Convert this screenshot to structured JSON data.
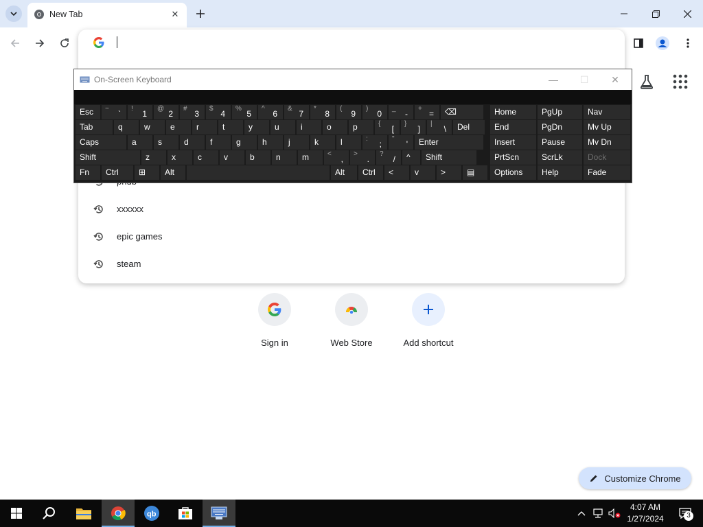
{
  "browser": {
    "tab_title": "New Tab",
    "omnibox_value": "",
    "suggestions": [
      "phub",
      "xxxxxx",
      "epic games",
      "steam"
    ]
  },
  "ntp": {
    "shortcuts": [
      {
        "name": "Sign in",
        "icon": "google-g-icon"
      },
      {
        "name": "Web Store",
        "icon": "chrome-web-store-icon"
      },
      {
        "name": "Add shortcut",
        "icon": "plus-icon"
      }
    ],
    "customize_label": "Customize Chrome"
  },
  "osk": {
    "title": "On-Screen Keyboard",
    "row1": [
      {
        "main": "Esc"
      },
      {
        "sym": "~",
        "num": "`"
      },
      {
        "sym": "!",
        "num": "1"
      },
      {
        "sym": "@",
        "num": "2"
      },
      {
        "sym": "#",
        "num": "3"
      },
      {
        "sym": "$",
        "num": "4"
      },
      {
        "sym": "%",
        "num": "5"
      },
      {
        "sym": "^",
        "num": "6"
      },
      {
        "sym": "&",
        "num": "7"
      },
      {
        "sym": "*",
        "num": "8"
      },
      {
        "sym": "(",
        "num": "9"
      },
      {
        "sym": ")",
        "num": "0"
      },
      {
        "sym": "_",
        "num": "-"
      },
      {
        "sym": "+",
        "num": "="
      },
      {
        "main": "⌫"
      }
    ],
    "row2": [
      "Tab",
      "q",
      "w",
      "e",
      "r",
      "t",
      "y",
      "u",
      "i",
      "o",
      "p",
      "[",
      "]",
      "\\",
      "Del"
    ],
    "row2_syms": {
      "[": "{",
      "]": "}",
      "\\": "|"
    },
    "row3": [
      "Caps",
      "a",
      "s",
      "d",
      "f",
      "g",
      "h",
      "j",
      "k",
      "l",
      ";",
      "'",
      "Enter"
    ],
    "row3_syms": {
      ";": ":",
      "'": "\""
    },
    "row4": [
      "Shift",
      "z",
      "x",
      "c",
      "v",
      "b",
      "n",
      "m",
      ",",
      ".",
      "/",
      "^",
      "Shift"
    ],
    "row4_syms": {
      ",": "<",
      ".": ">",
      "/": "?"
    },
    "row5": [
      "Fn",
      "Ctrl",
      "⊞",
      "Alt",
      "",
      "Alt",
      "Ctrl",
      "<",
      "v",
      ">",
      "▤"
    ],
    "nav_keys": [
      [
        "Home",
        "PgUp",
        "Nav"
      ],
      [
        "End",
        "PgDn",
        "Mv Up"
      ],
      [
        "Insert",
        "Pause",
        "Mv Dn"
      ],
      [
        "PrtScn",
        "ScrLk",
        "Dock"
      ],
      [
        "Options",
        "Help",
        "Fade"
      ]
    ]
  },
  "taskbar": {
    "time": "4:07 AM",
    "date": "1/27/2024",
    "notifications": "3"
  }
}
